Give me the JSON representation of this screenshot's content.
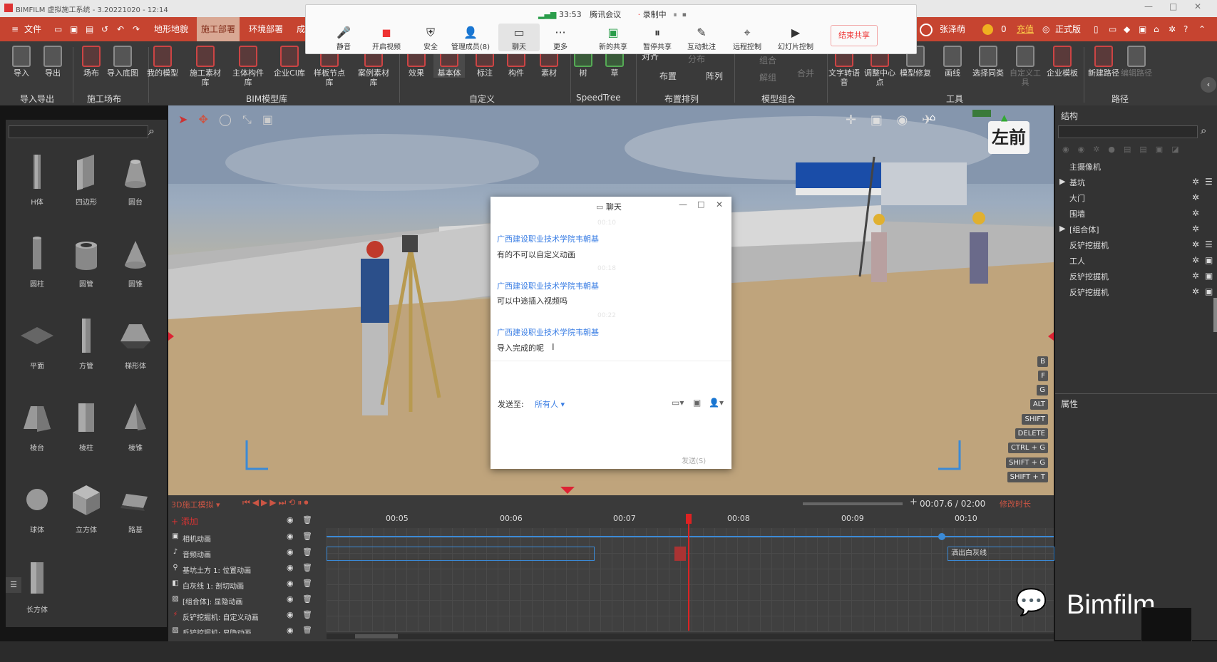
{
  "window": {
    "title": "BIMFILM 虚拟施工系统 - 3.20221020 - 12:14",
    "min": "—",
    "max": "□",
    "close": "✕"
  },
  "menubar": {
    "file": "文件",
    "tabs": [
      "地形地貌",
      "施工部署",
      "环境部署",
      "成"
    ],
    "active_tab": "施工部署",
    "user": "张泽萌",
    "coins": "0",
    "recharge": "充值",
    "license": "正式版"
  },
  "meeting": {
    "timer": "33:53",
    "app": "腾讯会议",
    "recording": "录制中",
    "buttons": [
      "静音",
      "开启视频",
      "安全",
      "管理成员(8)",
      "聊天",
      "更多",
      "新的共享",
      "暂停共享",
      "互动批注",
      "远程控制",
      "幻灯片控制"
    ],
    "end_share": "结束共享"
  },
  "ribbon": {
    "buttons": [
      {
        "label": "导入"
      },
      {
        "label": "导出"
      },
      {
        "label": "场布"
      },
      {
        "label": "导入底图"
      },
      {
        "label": "我的模型"
      },
      {
        "label": "施工素材库"
      },
      {
        "label": "主体构件库"
      },
      {
        "label": "企业CI库"
      },
      {
        "label": "样板节点库"
      },
      {
        "label": "案例素材库"
      },
      {
        "label": "效果"
      },
      {
        "label": "基本体"
      },
      {
        "label": "标注"
      },
      {
        "label": "构件"
      },
      {
        "label": "素材"
      },
      {
        "label": "树"
      },
      {
        "label": "草"
      },
      {
        "label": "文字转语音"
      },
      {
        "label": "调整中心点"
      },
      {
        "label": "模型修复"
      },
      {
        "label": "画线"
      },
      {
        "label": "选择同类"
      },
      {
        "label": "自定义工具"
      },
      {
        "label": "企业模板"
      },
      {
        "label": "新建路径"
      },
      {
        "label": "编辑路径"
      }
    ],
    "small": {
      "align": "对齐",
      "layout": "布置",
      "distribute": "分布",
      "array": "阵列",
      "combine": "组合",
      "uncombine": "解组",
      "merge": "合并"
    },
    "groups": [
      "导入导出",
      "施工场布",
      "BIM模型库",
      "自定义",
      "SpeedTree",
      "布置排列",
      "模型组合",
      "工具",
      "路径"
    ]
  },
  "left_panel": {
    "shapes": [
      "H体",
      "四边形",
      "圆台",
      "圆柱",
      "圆管",
      "圆锥",
      "平面",
      "方管",
      "梯形体",
      "棱台",
      "棱柱",
      "棱锥",
      "球体",
      "立方体",
      "路基",
      "长方体"
    ]
  },
  "viewport": {
    "view_cube": "左前",
    "keys": [
      "B",
      "F",
      "G",
      "ALT",
      "SHIFT",
      "DELETE",
      "CTRL + G",
      "SHIFT + G",
      "SHIFT + T"
    ]
  },
  "right_panel": {
    "structure_title": "结构",
    "items": [
      "主摄像机",
      "基坑",
      "大门",
      "围墙",
      "[组合体]",
      "反铲挖掘机",
      "工人",
      "反铲挖掘机",
      "反铲挖掘机"
    ],
    "properties_title": "属性"
  },
  "chat": {
    "title": "聊天",
    "messages": [
      {
        "time": "00:10",
        "sender": "广西建设职业技术学院韦朝基",
        "text": "有的不可以自定义动画"
      },
      {
        "time": "00:18",
        "sender": "广西建设职业技术学院韦朝基",
        "text": "可以中途插入视频吗"
      },
      {
        "time": "00:22",
        "sender": "广西建设职业技术学院韦朝基",
        "text": "导入完成的呢"
      }
    ],
    "send_to_label": "发送至:",
    "send_to_value": "所有人",
    "send_button": "发送(S)"
  },
  "timeline": {
    "mode": "3D施工模拟",
    "add": "添加",
    "current_time": "00:07.6",
    "total_time": "02:00",
    "modify_length": "修改时长",
    "ticks": [
      "00:05",
      "00:06",
      "00:07",
      "00:08",
      "00:09",
      "00:10"
    ],
    "tracks": [
      "相机动画",
      "音频动画",
      "基坑土方 1: 位置动画",
      "白灰线 1: 剖切动画",
      "[组合体]: 显隐动画",
      "反铲挖掘机: 自定义动画",
      "反铲挖掘机: 显隐动画"
    ],
    "clip_label": "洒出白灰线"
  },
  "watermark": "Bimfilm"
}
